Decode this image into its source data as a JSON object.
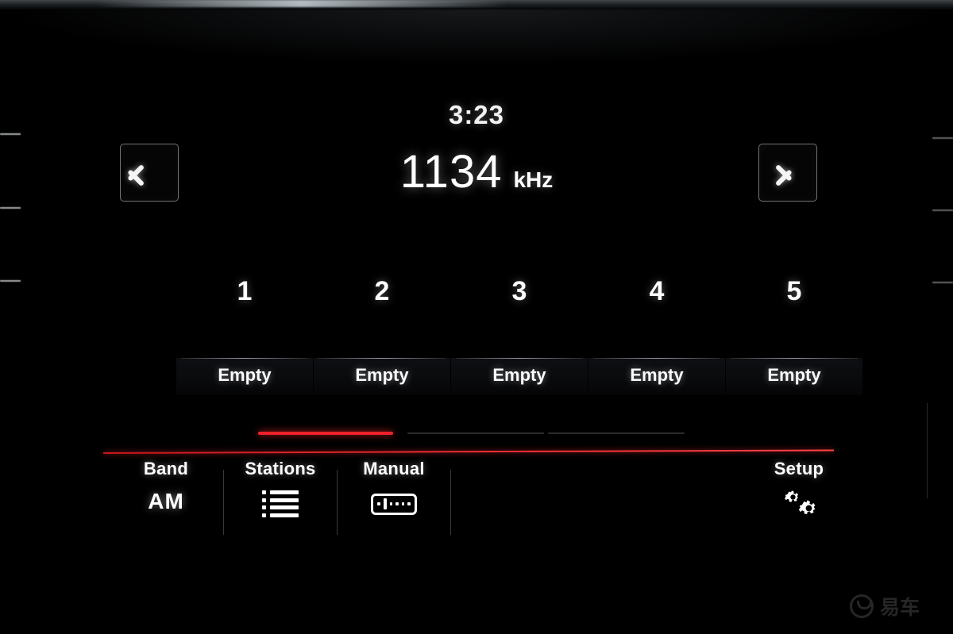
{
  "device": {
    "screen_label": "car-radio-am-tuner",
    "accent_color": "#f0222a",
    "text_color": "#ffffff",
    "background_color": "#000000"
  },
  "header": {
    "clock": "3:23",
    "frequency_value": "1134",
    "frequency_unit": "kHz"
  },
  "nav": {
    "prev_icon": "chevron-left-icon",
    "next_icon": "chevron-right-icon"
  },
  "presets": [
    {
      "number": "1",
      "label": "Empty"
    },
    {
      "number": "2",
      "label": "Empty"
    },
    {
      "number": "3",
      "label": "Empty"
    },
    {
      "number": "4",
      "label": "Empty"
    },
    {
      "number": "5",
      "label": "Empty"
    }
  ],
  "page_indicator": {
    "total": 3,
    "active_index": 1
  },
  "bottom_bar": {
    "band": {
      "title": "Band",
      "value": "AM"
    },
    "stations": {
      "title": "Stations",
      "icon": "list-icon"
    },
    "manual": {
      "title": "Manual",
      "icon": "tuner-bar-icon"
    },
    "setup": {
      "title": "Setup",
      "icon": "gears-icon"
    }
  },
  "watermark": {
    "text": "易车"
  }
}
